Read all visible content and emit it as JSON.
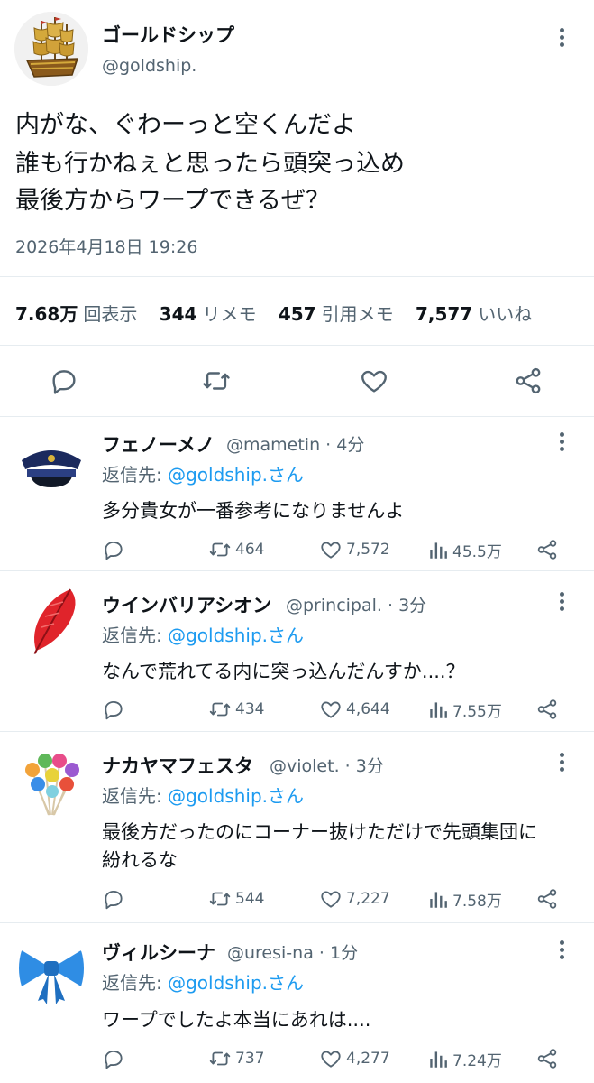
{
  "main_post": {
    "display_name": "ゴールドシップ",
    "handle": "@goldship.",
    "body_lines": [
      "内がな、ぐわーっと空くんだよ",
      "誰も行かねぇと思ったら頭突っ込め",
      "最後方からワープできるぜ？"
    ],
    "timestamp": "2026年4月18日 19:26",
    "stats": {
      "views_value": "7.68万",
      "views_label": "回表示",
      "reposts_value": "344",
      "reposts_label": "リメモ",
      "quotes_value": "457",
      "quotes_label": "引用メモ",
      "likes_value": "7,577",
      "likes_label": "いいね"
    },
    "avatar_icon": "golden-ship-icon"
  },
  "reply_prefix": "返信先:",
  "replies": [
    {
      "display_name": "フェノーメノ",
      "handle": "@mametin",
      "time": "· 4分",
      "reply_to": "@goldship.さん",
      "lines": [
        "多分貴女が一番参考になりませんよ"
      ],
      "reposts": "464",
      "likes": "7,572",
      "views": "45.5万",
      "avatar_icon": "police-cap-icon"
    },
    {
      "display_name": "ウインバリアシオン",
      "handle": "@principal.",
      "time": "· 3分",
      "reply_to": "@goldship.さん",
      "lines": [
        "なんで荒れてる内に突っ込んだんすか....？"
      ],
      "reposts": "434",
      "likes": "4,644",
      "views": "7.55万",
      "avatar_icon": "red-feather-icon"
    },
    {
      "display_name": "ナカヤマフェスタ",
      "handle": "@violet.",
      "time": "· 3分",
      "reply_to": "@goldship.さん",
      "lines": [
        "最後方だったのにコーナー抜けただけで先頭集団に",
        "紛れるな"
      ],
      "reposts": "544",
      "likes": "7,227",
      "views": "7.58万",
      "avatar_icon": "lollipops-icon"
    },
    {
      "display_name": "ヴィルシーナ",
      "handle": "@uresi-na",
      "time": "· 1分",
      "reply_to": "@goldship.さん",
      "lines": [
        "ワープでしたよ本当にあれは...."
      ],
      "reposts": "737",
      "likes": "4,277",
      "views": "7.24万",
      "avatar_icon": "blue-ribbon-icon"
    }
  ],
  "colors": {
    "link": "#1d9bf0",
    "secondary_text": "#536471",
    "divider": "#e6ecf0"
  }
}
